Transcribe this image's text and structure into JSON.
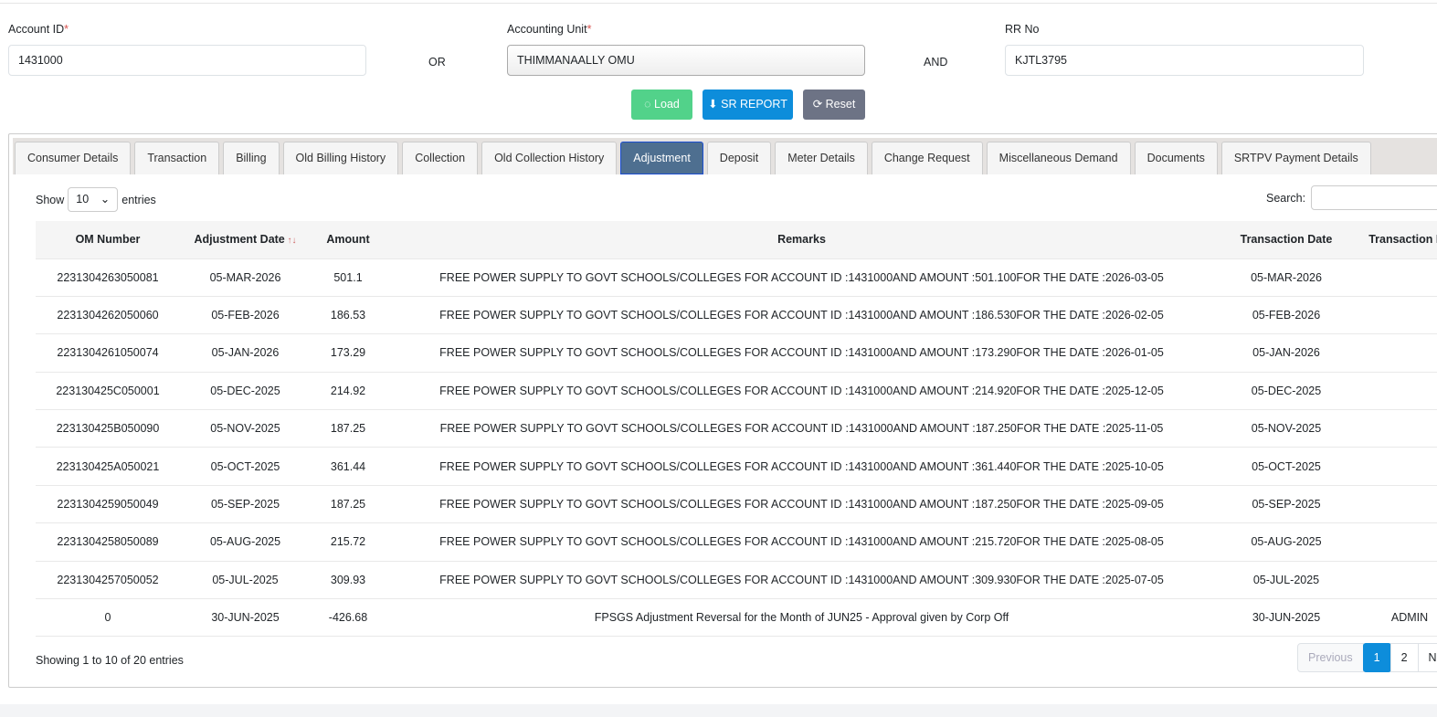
{
  "form": {
    "account_id_label": "Account ID",
    "account_id_value": "1431000",
    "or": "OR",
    "unit_label": "Accounting Unit",
    "unit_value": "THIMMANAALLY OMU",
    "and": "AND",
    "rr_label": "RR No",
    "rr_value": "KJTL3795",
    "req": "*"
  },
  "buttons": {
    "load": "Load",
    "sr_report": "SR REPORT",
    "reset": "Reset"
  },
  "tabs": [
    "Consumer Details",
    "Transaction",
    "Billing",
    "Old Billing History",
    "Collection",
    "Old Collection History",
    "Adjustment",
    "Deposit",
    "Meter Details",
    "Change Request",
    "Miscellaneous Demand",
    "Documents",
    "SRTPV Payment Details"
  ],
  "table_controls": {
    "show": "Show",
    "entries_value": "10",
    "entries": "entries",
    "search": "Search:"
  },
  "columns": [
    "OM Number",
    "Adjustment Date",
    "Amount",
    "Remarks",
    "Transaction Date",
    "Transaction By"
  ],
  "rows": [
    [
      "2231304263050081",
      "05-MAR-2026",
      "501.1",
      "FREE POWER SUPPLY TO GOVT SCHOOLS/COLLEGES FOR ACCOUNT ID :1431000AND AMOUNT :501.100FOR THE DATE :2026-03-05",
      "05-MAR-2026",
      ""
    ],
    [
      "2231304262050060",
      "05-FEB-2026",
      "186.53",
      "FREE POWER SUPPLY TO GOVT SCHOOLS/COLLEGES FOR ACCOUNT ID :1431000AND AMOUNT :186.530FOR THE DATE :2026-02-05",
      "05-FEB-2026",
      ""
    ],
    [
      "2231304261050074",
      "05-JAN-2026",
      "173.29",
      "FREE POWER SUPPLY TO GOVT SCHOOLS/COLLEGES FOR ACCOUNT ID :1431000AND AMOUNT :173.290FOR THE DATE :2026-01-05",
      "05-JAN-2026",
      ""
    ],
    [
      "223130425C050001",
      "05-DEC-2025",
      "214.92",
      "FREE POWER SUPPLY TO GOVT SCHOOLS/COLLEGES FOR ACCOUNT ID :1431000AND AMOUNT :214.920FOR THE DATE :2025-12-05",
      "05-DEC-2025",
      ""
    ],
    [
      "223130425B050090",
      "05-NOV-2025",
      "187.25",
      "FREE POWER SUPPLY TO GOVT SCHOOLS/COLLEGES FOR ACCOUNT ID :1431000AND AMOUNT :187.250FOR THE DATE :2025-11-05",
      "05-NOV-2025",
      ""
    ],
    [
      "223130425A050021",
      "05-OCT-2025",
      "361.44",
      "FREE POWER SUPPLY TO GOVT SCHOOLS/COLLEGES FOR ACCOUNT ID :1431000AND AMOUNT :361.440FOR THE DATE :2025-10-05",
      "05-OCT-2025",
      ""
    ],
    [
      "2231304259050049",
      "05-SEP-2025",
      "187.25",
      "FREE POWER SUPPLY TO GOVT SCHOOLS/COLLEGES FOR ACCOUNT ID :1431000AND AMOUNT :187.250FOR THE DATE :2025-09-05",
      "05-SEP-2025",
      ""
    ],
    [
      "2231304258050089",
      "05-AUG-2025",
      "215.72",
      "FREE POWER SUPPLY TO GOVT SCHOOLS/COLLEGES FOR ACCOUNT ID :1431000AND AMOUNT :215.720FOR THE DATE :2025-08-05",
      "05-AUG-2025",
      ""
    ],
    [
      "2231304257050052",
      "05-JUL-2025",
      "309.93",
      "FREE POWER SUPPLY TO GOVT SCHOOLS/COLLEGES FOR ACCOUNT ID :1431000AND AMOUNT :309.930FOR THE DATE :2025-07-05",
      "05-JUL-2025",
      ""
    ],
    [
      "0",
      "30-JUN-2025",
      "-426.68",
      "FPSGS Adjustment Reversal for the Month of JUN25 - Approval given by Corp Off",
      "30-JUN-2025",
      "ADMIN"
    ]
  ],
  "footer": {
    "info": "Showing 1 to 10 of 20 entries",
    "previous": "Previous",
    "page1": "1",
    "page2": "2",
    "next": "Next"
  }
}
